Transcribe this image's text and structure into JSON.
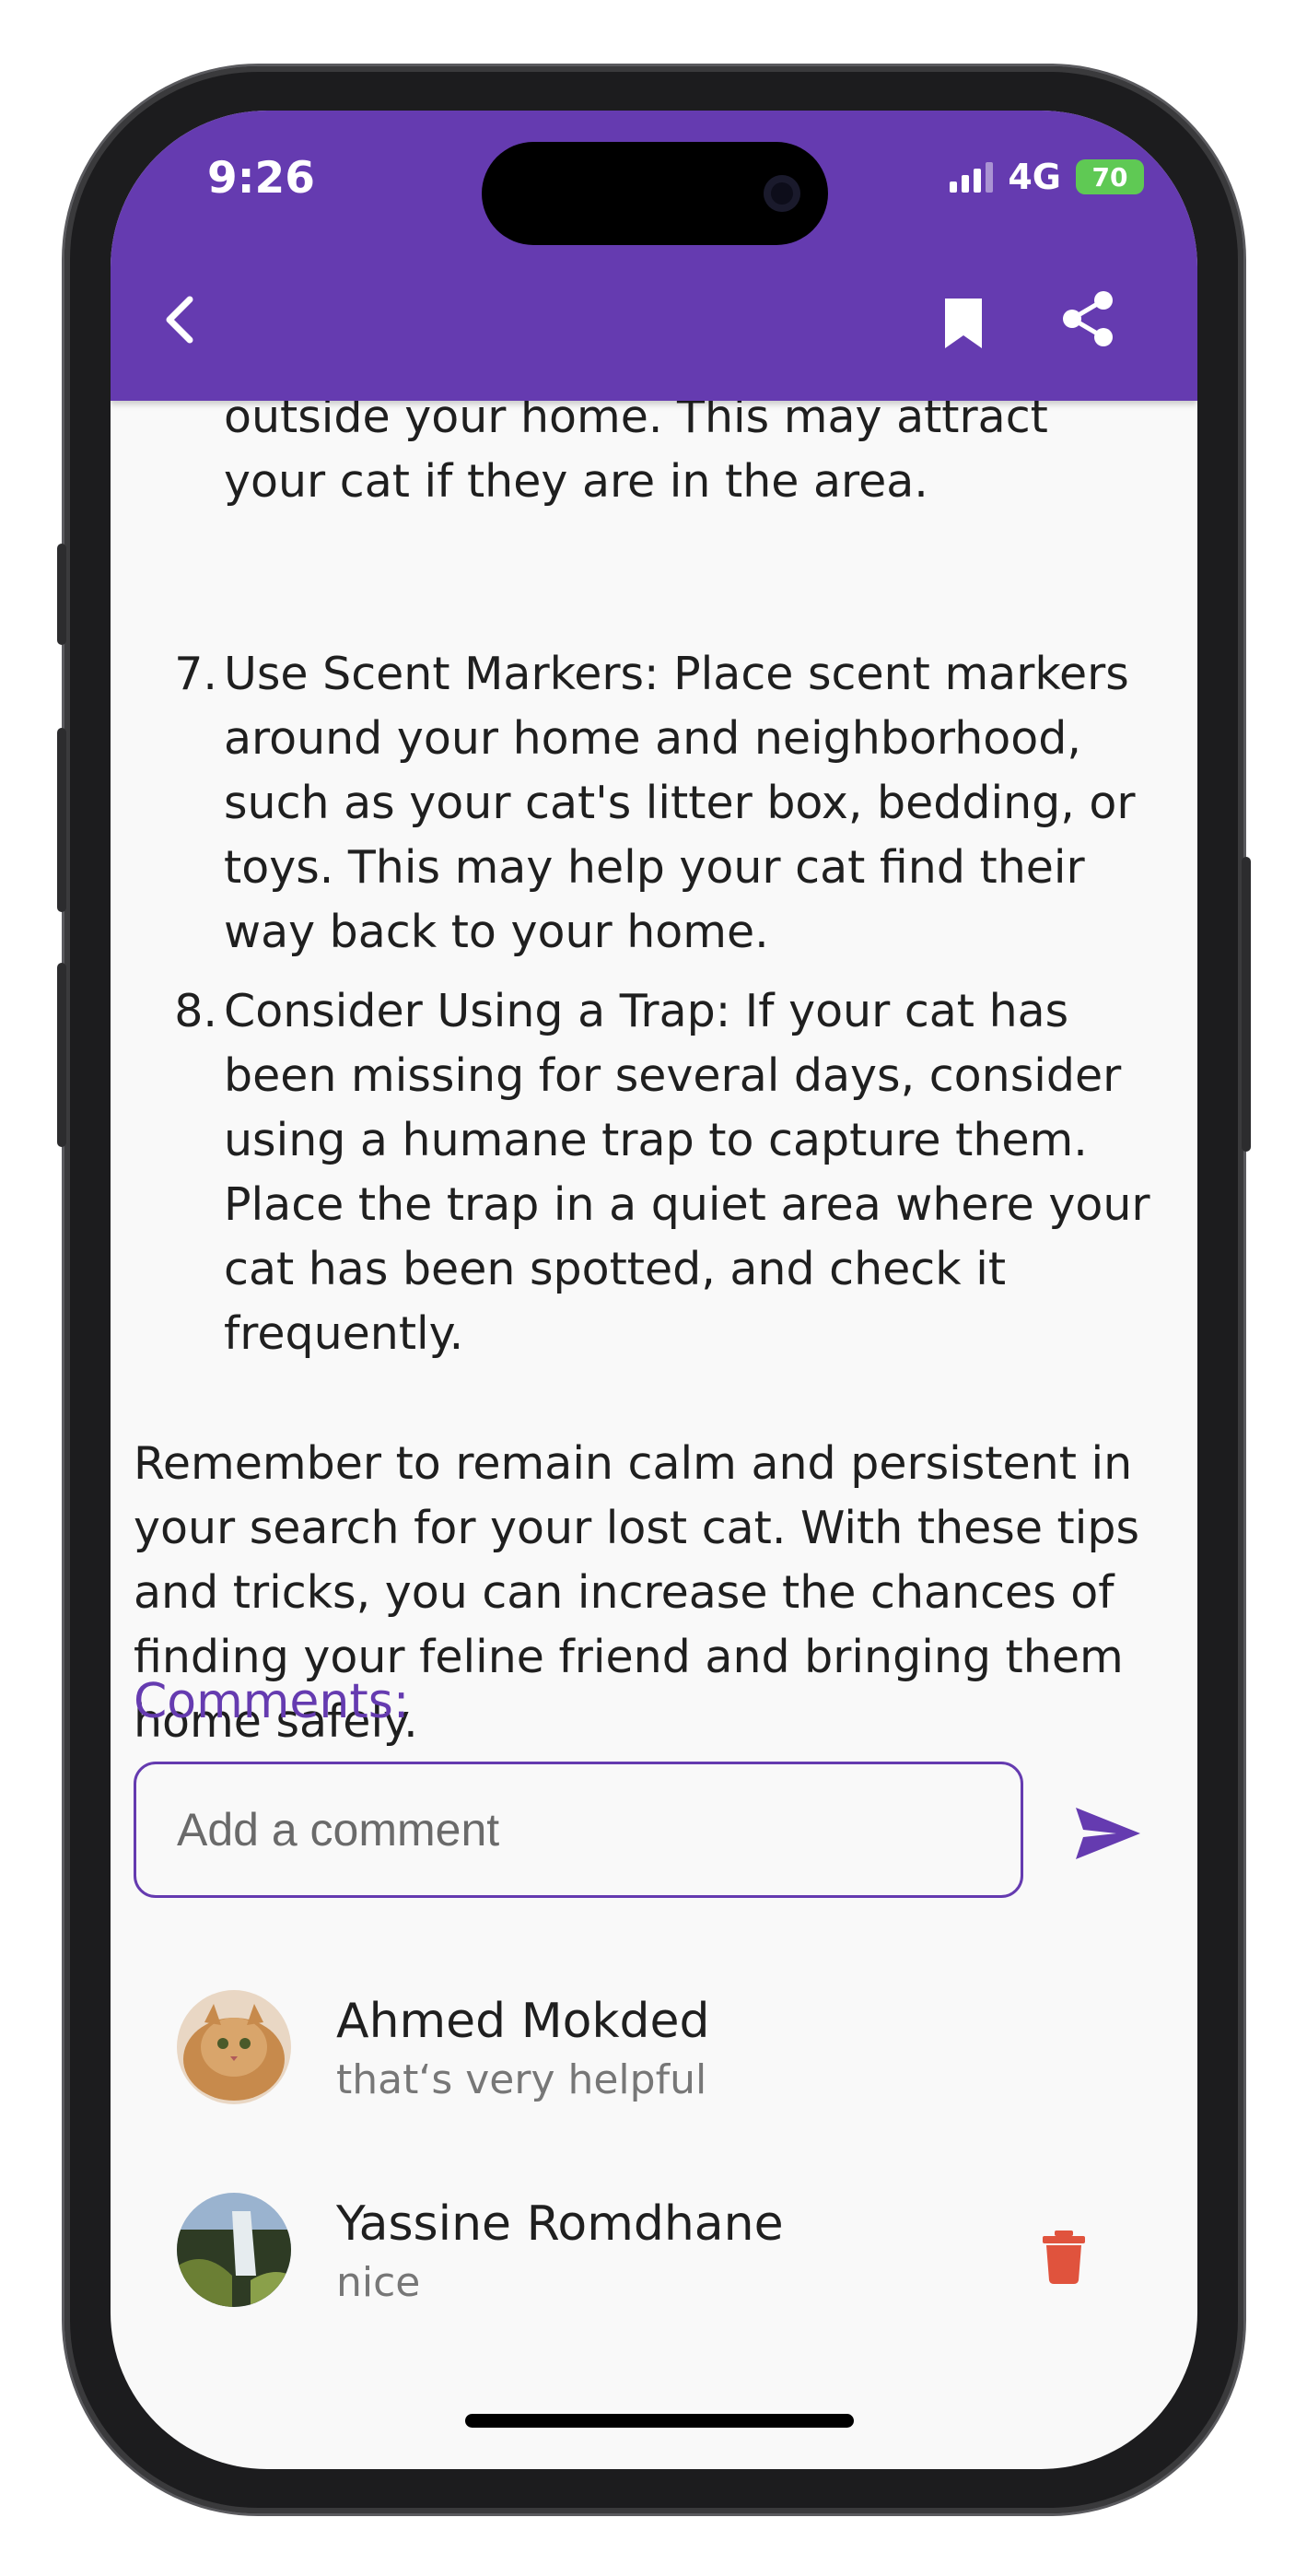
{
  "status": {
    "time": "9:26",
    "network": "4G",
    "battery": "70"
  },
  "list_items": [
    {
      "number": "",
      "lines": [
        "outside your home. This may attract",
        "your cat if they are in the area."
      ]
    },
    {
      "number": "7.",
      "lines": [
        "Use Scent Markers: Place scent markers",
        "around your home and neighborhood,",
        "such as your cat's litter box, bedding, or",
        "toys. This may help your cat find their",
        "way back to your home."
      ]
    },
    {
      "number": "8.",
      "lines": [
        "Consider Using a Trap: If your cat has",
        "been missing for several days, consider",
        "using a humane trap to capture them.",
        "Place the trap in a quiet area where your",
        "cat has been spotted, and check it",
        "frequently."
      ]
    }
  ],
  "closing_paragraph": [
    "Remember to remain calm and persistent in",
    "your search for your lost cat. With these tips",
    "and tricks, you can increase the chances of",
    "finding your feline friend and bringing them",
    "home safely."
  ],
  "comments": {
    "title": "Comments:",
    "input_placeholder": "Add a comment",
    "items": [
      {
        "name": "Ahmed Mokded",
        "text": "that‘s very helpful"
      },
      {
        "name": "Yassine Romdhane",
        "text": "nice"
      }
    ]
  },
  "colors": {
    "primary": "#653bb0",
    "delete": "#e0533d",
    "background": "#f9f9f9"
  },
  "icons": {
    "back": "chevron-left",
    "bookmark": "bookmark",
    "share": "share",
    "send": "send",
    "delete": "trash"
  }
}
